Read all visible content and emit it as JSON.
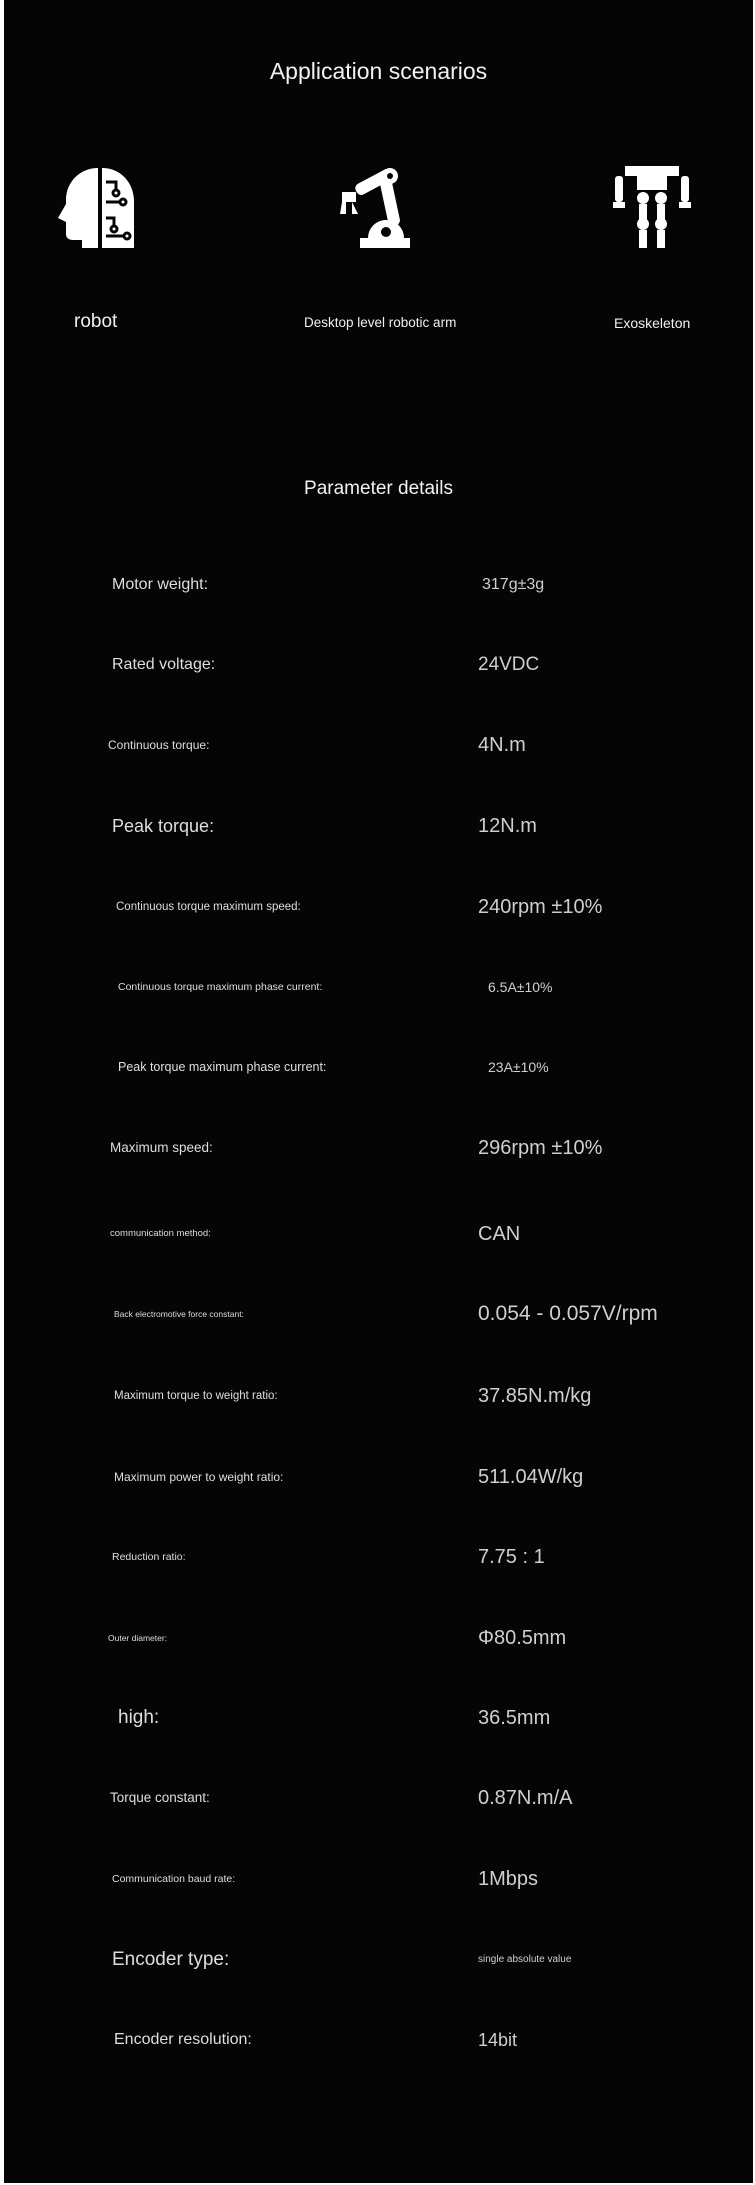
{
  "scenarios": {
    "title": "Application scenarios",
    "items": [
      {
        "label": "robot",
        "icon": "robot-head-circuit-icon"
      },
      {
        "label": "Desktop level robotic arm",
        "icon": "robotic-arm-icon"
      },
      {
        "label": "Exoskeleton",
        "icon": "exoskeleton-icon"
      }
    ]
  },
  "parameters": {
    "title": "Parameter details",
    "rows": [
      {
        "name": "Motor weight:",
        "value": "317g±3g"
      },
      {
        "name": "Rated voltage:",
        "value": "24VDC"
      },
      {
        "name": "Continuous torque:",
        "value": "4N.m"
      },
      {
        "name": "Peak torque:",
        "value": "12N.m"
      },
      {
        "name": "Continuous torque maximum speed:",
        "value": "240rpm ±10%"
      },
      {
        "name": "Continuous torque maximum phase current:",
        "value": "6.5A±10%"
      },
      {
        "name": "Peak torque maximum phase current:",
        "value": "23A±10%"
      },
      {
        "name": "Maximum speed:",
        "value": "296rpm ±10%"
      },
      {
        "name": "communication method:",
        "value": "CAN"
      },
      {
        "name": "Back electromotive force constant:",
        "value": "0.054 - 0.057V/rpm"
      },
      {
        "name": "Maximum torque to weight ratio:",
        "value": "37.85N.m/kg"
      },
      {
        "name": "Maximum power to weight ratio:",
        "value": "511.04W/kg"
      },
      {
        "name": "Reduction ratio:",
        "value": "7.75 : 1"
      },
      {
        "name": "Outer diameter:",
        "value": "Φ80.5mm"
      },
      {
        "name": "high:",
        "value": "36.5mm"
      },
      {
        "name": "Torque constant:",
        "value": "0.87N.m/A"
      },
      {
        "name": "Communication baud rate:",
        "value": "1Mbps"
      },
      {
        "name": "Encoder type:",
        "value": "single absolute value"
      },
      {
        "name": "Encoder resolution:",
        "value": "14bit"
      }
    ]
  },
  "colors": {
    "background": "#050505",
    "text": "#e8e8e8",
    "icon": "#ffffff"
  }
}
